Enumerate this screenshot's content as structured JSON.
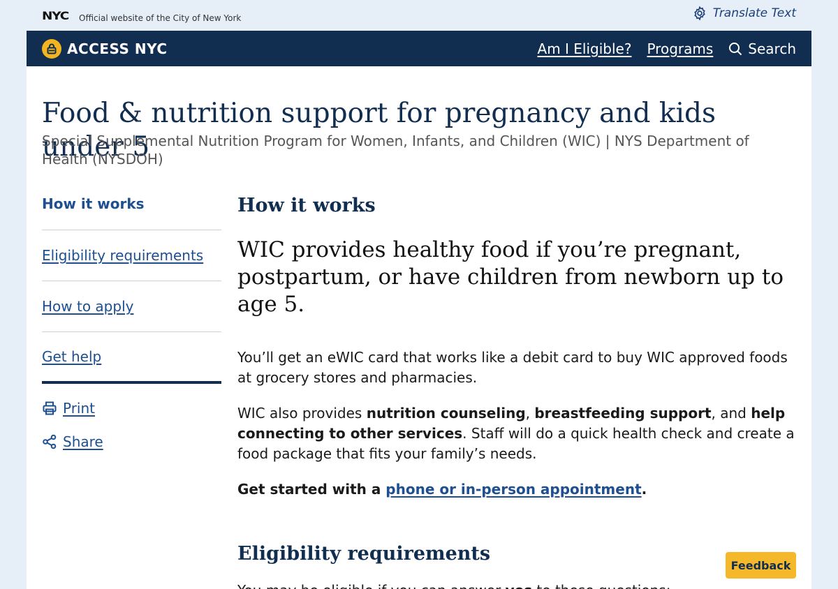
{
  "topbar": {
    "logo": "NYC",
    "official_text": "Official website of the City of New York",
    "translate_label": "Translate Text"
  },
  "header": {
    "brand": "ACCESS NYC",
    "nav": [
      {
        "label": "Am I Eligible?"
      },
      {
        "label": "Programs"
      },
      {
        "label": "Search"
      }
    ]
  },
  "page": {
    "title": "Food & nutrition support for pregnancy and kids under 5",
    "subtitle": "Special Supplemental Nutrition Program for Women, Infants, and Children (WIC) | NYS Department of Health (NYSDOH)"
  },
  "sidebar": {
    "items": [
      {
        "label": "How it works"
      },
      {
        "label": "Eligibility requirements"
      },
      {
        "label": "How to apply"
      },
      {
        "label": "Get help"
      }
    ],
    "actions": [
      {
        "label": "Print",
        "icon": "printer-icon"
      },
      {
        "label": "Share",
        "icon": "share-icon"
      }
    ]
  },
  "content": {
    "section1_heading": "How it works",
    "lead": "WIC provides healthy food if you’re pregnant, postpartum, or have children from newborn up to age 5.",
    "p1": "You’ll get an eWIC card that works like a debit card to buy WIC approved foods at grocery stores and pharmacies.",
    "p2": {
      "t1": "WIC also provides ",
      "b1": "nutrition counseling",
      "t2": ", ",
      "b2": "breastfeeding support",
      "t3": ", and ",
      "b3": "help connecting to other services",
      "t4": ". Staff will do a quick health check and create a food package that fits your family’s needs."
    },
    "p3": {
      "prefix": "Get started with a ",
      "link": "phone or in-person appointment",
      "suffix": "."
    },
    "section2_heading": "Eligibility requirements",
    "p4": {
      "prefix": "You may be eligible if you can answer ",
      "bold": "yes",
      "suffix": " to these questions:"
    }
  },
  "feedback_label": "Feedback",
  "colors": {
    "navy": "#112e51",
    "link": "#1d4f91",
    "accent": "#f5b82a",
    "background": "#e6eef8"
  }
}
